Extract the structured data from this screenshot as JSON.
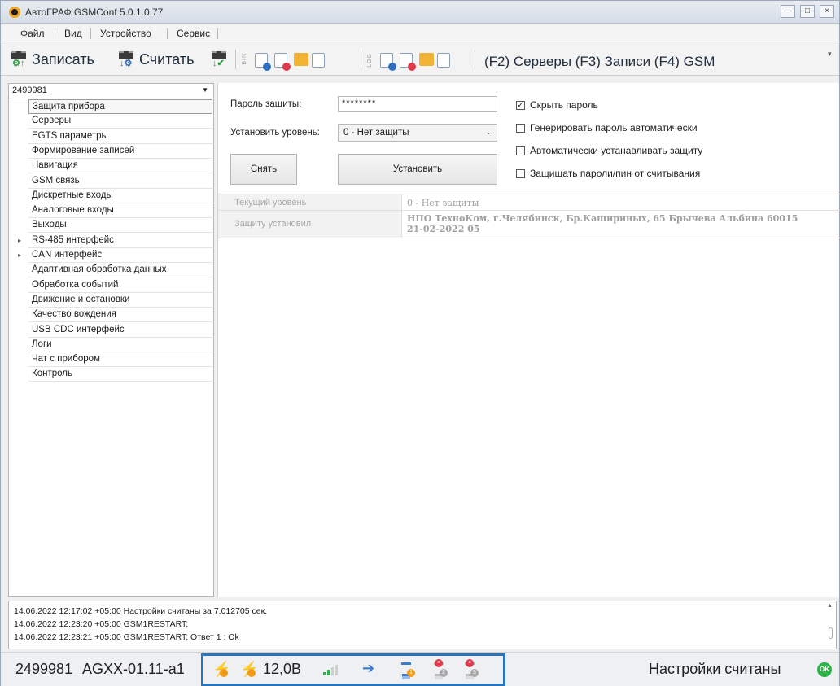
{
  "window": {
    "title": "АвтоГРАФ GSMConf 5.0.1.0.77",
    "min_glyph": "—",
    "max_glyph": "□",
    "close_glyph": "×"
  },
  "menu": [
    "Файл",
    "Вид",
    "Устройство",
    "Сервис"
  ],
  "toolbar": {
    "write_label": "Записать",
    "read_label": "Считать",
    "bin_label": "BIN",
    "log_label": "LOG",
    "quick_links": "(F2) Серверы (F3) Записи (F4) GSM"
  },
  "tree": {
    "device_id": "2499981",
    "items": [
      "Защита прибора",
      "Серверы",
      "EGTS параметры",
      "Формирование записей",
      "Навигация",
      "GSM связь",
      "Дискретные входы",
      "Аналоговые входы",
      "Выходы",
      "RS-485 интерфейс",
      "CAN интерфейс",
      "Адаптивная обработка данных",
      "Обработка событий",
      "Движение и остановки",
      "Качество вождения",
      "USB CDC интерфейс",
      "Логи",
      "Чат с прибором",
      "Контроль"
    ]
  },
  "protection": {
    "password_label": "Пароль защиты:",
    "password_value": "********",
    "level_label": "Установить уровень:",
    "level_value": "0 - Нет защиты",
    "remove_button": "Снять",
    "set_button": "Установить",
    "checkboxes": [
      {
        "label": "Скрыть пароль",
        "checked": true,
        "mark": "✓"
      },
      {
        "label": "Генерировать пароль автоматически",
        "checked": false,
        "mark": ""
      },
      {
        "label": "Автоматически устанавливать защиту",
        "checked": false,
        "mark": ""
      },
      {
        "label": "Защищать пароли/пин от считывания",
        "checked": false,
        "mark": ""
      }
    ],
    "info": [
      {
        "key": "Текущий уровень",
        "value": "0 - Нет защиты"
      },
      {
        "key": "Защиту установил",
        "value": "НПО ТехноКом, г.Челябинск, Бр.Кашириных, 65 Брычева Альбина 60015 21-02-2022 05"
      }
    ]
  },
  "log": [
    "14.06.2022 12:17:02 +05:00 Настройки считаны за 7,012705 сек.",
    "14.06.2022 12:23:20 +05:00 GSM1RESTART;",
    "14.06.2022 12:23:21 +05:00 GSM1RESTART; Ответ 1 : Ok"
  ],
  "status": {
    "device_id": "2499981",
    "firmware": "AGXX-01.11-a1",
    "voltage": "12,0В",
    "badge_1": "1",
    "badge_2": "2",
    "badge_3": "3",
    "message": "Настройки считаны",
    "ok_label": "OK",
    "colors": {
      "highlight": "#2a73b8",
      "ok": "#2db34a",
      "warn": "#f19a17",
      "error": "#e0394a"
    }
  }
}
